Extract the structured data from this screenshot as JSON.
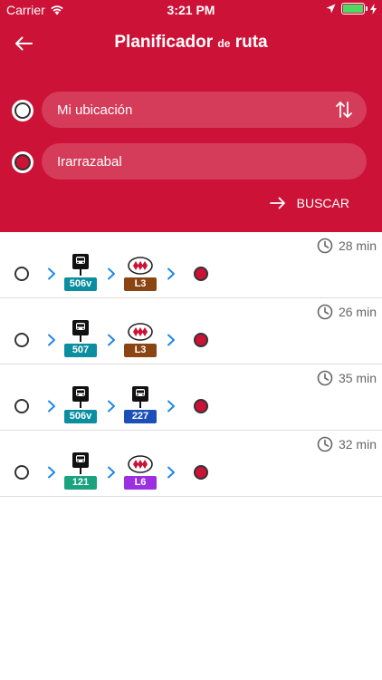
{
  "status_bar": {
    "carrier": "Carrier",
    "time": "3:21 PM"
  },
  "header": {
    "title_part1": "Planificador",
    "title_part2": "de",
    "title_part3": "ruta",
    "background_color": "#cc1236"
  },
  "origin": {
    "value": "Mi ubicación"
  },
  "destination": {
    "value": "Irarrazabal"
  },
  "search_button": {
    "label": "BUSCAR"
  },
  "routes": [
    {
      "duration": "28 min",
      "legs": [
        {
          "type": "bus",
          "label": "506v",
          "color": "#0a8ea0",
          "icon": "bus-icon"
        },
        {
          "type": "metro",
          "label": "L3",
          "color": "#8b4513",
          "icon": "metro-icon"
        }
      ]
    },
    {
      "duration": "26 min",
      "legs": [
        {
          "type": "bus",
          "label": "507",
          "color": "#0a8ea0",
          "icon": "bus-icon"
        },
        {
          "type": "metro",
          "label": "L3",
          "color": "#8b4513",
          "icon": "metro-icon"
        }
      ]
    },
    {
      "duration": "35 min",
      "legs": [
        {
          "type": "bus",
          "label": "506v",
          "color": "#0a8ea0",
          "icon": "bus-icon"
        },
        {
          "type": "bus",
          "label": "227",
          "color": "#1c4fb8",
          "icon": "bus-icon"
        }
      ]
    },
    {
      "duration": "32 min",
      "legs": [
        {
          "type": "bus",
          "label": "121",
          "color": "#1aa37f",
          "icon": "bus-icon"
        },
        {
          "type": "metro",
          "label": "L6",
          "color": "#9b30e0",
          "icon": "metro-icon"
        }
      ]
    }
  ],
  "icons": {
    "chevron_color": "#1e88e5",
    "destination_color": "#cc1236"
  }
}
